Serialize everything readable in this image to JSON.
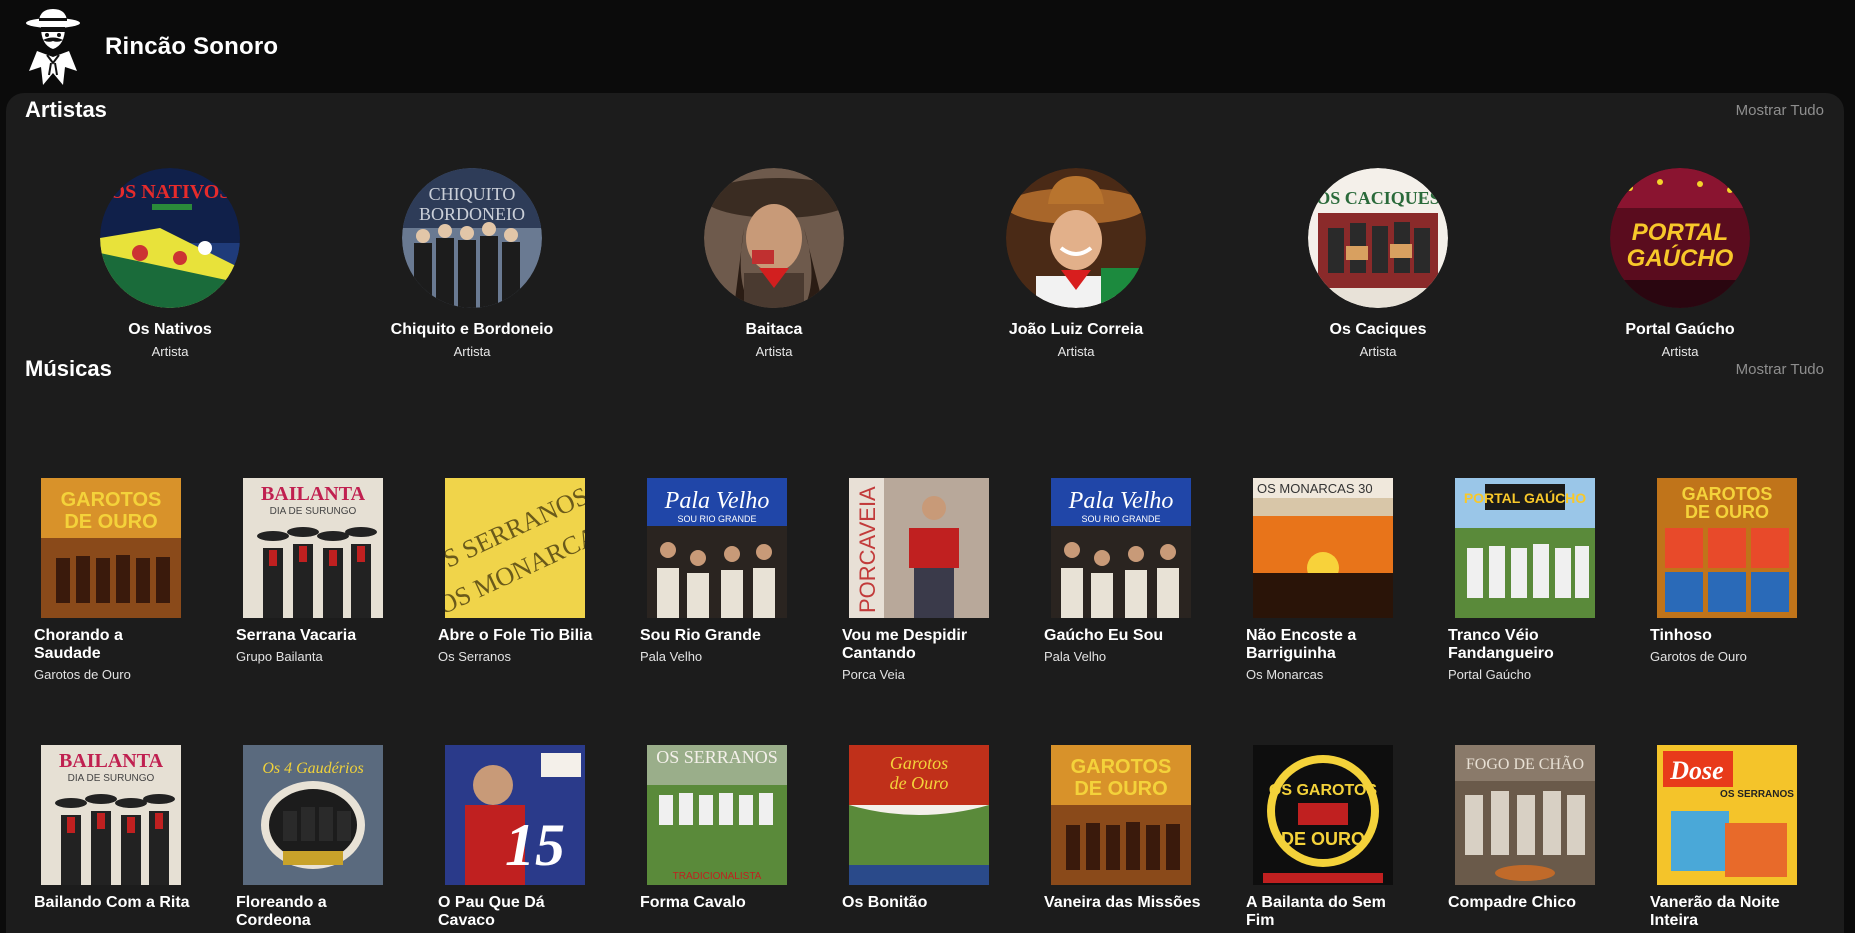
{
  "app": {
    "title": "Rincão Sonoro",
    "logo_icon": "gaucho-hat-mustache-icon"
  },
  "artists_section": {
    "title": "Artistas",
    "show_all": "Mostrar Tudo",
    "items": [
      {
        "name": "Os Nativos",
        "type": "Artista",
        "image_text": "OS NATIVOS"
      },
      {
        "name": "Chiquito e Bordoneio",
        "type": "Artista",
        "image_text": "CHIQUITO & BORDONEIO"
      },
      {
        "name": "Baitaca",
        "type": "Artista",
        "image_text": ""
      },
      {
        "name": "João Luiz Correia",
        "type": "Artista",
        "image_text": ""
      },
      {
        "name": "Os Caciques",
        "type": "Artista",
        "image_text": "OS CACIQUES"
      },
      {
        "name": "Portal Gaúcho",
        "type": "Artista",
        "image_text": "PORTAL GAÚCHO"
      }
    ]
  },
  "songs_section": {
    "title": "Músicas",
    "show_all": "Mostrar Tudo",
    "rows": [
      [
        {
          "title": "Chorando a Saudade",
          "artist": "Garotos de Ouro",
          "cover_text": "GAROTOS DE OURO"
        },
        {
          "title": "Serrana Vacaria",
          "artist": "Grupo Bailanta",
          "cover_text": "BAILANTA"
        },
        {
          "title": "Abre o Fole Tio Bilia",
          "artist": "Os Serranos",
          "cover_text": "OS SERRANOS OS MONARCAS"
        },
        {
          "title": "Sou Rio Grande",
          "artist": "Pala Velho",
          "cover_text": "Pala Velho"
        },
        {
          "title": "Vou me Despidir Cantando",
          "artist": "Porca Veia",
          "cover_text": "PORCAVEIA"
        },
        {
          "title": "Gaúcho Eu Sou",
          "artist": "Pala Velho",
          "cover_text": "Pala Velho"
        },
        {
          "title": "Não Encoste a Barriguinha",
          "artist": "Os Monarcas",
          "cover_text": "OS MONARCAS"
        },
        {
          "title": "Tranco Véio Fandangueiro",
          "artist": "Portal Gaúcho",
          "cover_text": "PORTAL GAÚCHO"
        },
        {
          "title": "Tinhoso",
          "artist": "Garotos de Ouro",
          "cover_text": "GAROTOS DE OURO"
        }
      ],
      [
        {
          "title": "Bailando Com a Rita",
          "artist": "",
          "cover_text": "BAILANTA"
        },
        {
          "title": "Floreando a Cordeona",
          "artist": "",
          "cover_text": "Os 4 Gaudérios"
        },
        {
          "title": "O Pau Que Dá Cavaco",
          "artist": "",
          "cover_text": "15"
        },
        {
          "title": "Forma Cavalo",
          "artist": "",
          "cover_text": "OS SERRANOS"
        },
        {
          "title": "Os Bonitão",
          "artist": "",
          "cover_text": "Garotos de Ouro"
        },
        {
          "title": "Vaneira das Missões",
          "artist": "",
          "cover_text": "GAROTOS DE OURO"
        },
        {
          "title": "A Bailanta do Sem Fim",
          "artist": "",
          "cover_text": "OS GAROTOS DE OURO"
        },
        {
          "title": "Compadre Chico",
          "artist": "",
          "cover_text": "FOGO DE CHÃO"
        },
        {
          "title": "Vanerão da Noite Inteira",
          "artist": "",
          "cover_text": "OS SERRANOS"
        }
      ]
    ]
  },
  "colors": {
    "page_bg": "#0b0b0b",
    "panel_bg": "#1c1c1c",
    "muted_text": "#8e8e8e"
  }
}
